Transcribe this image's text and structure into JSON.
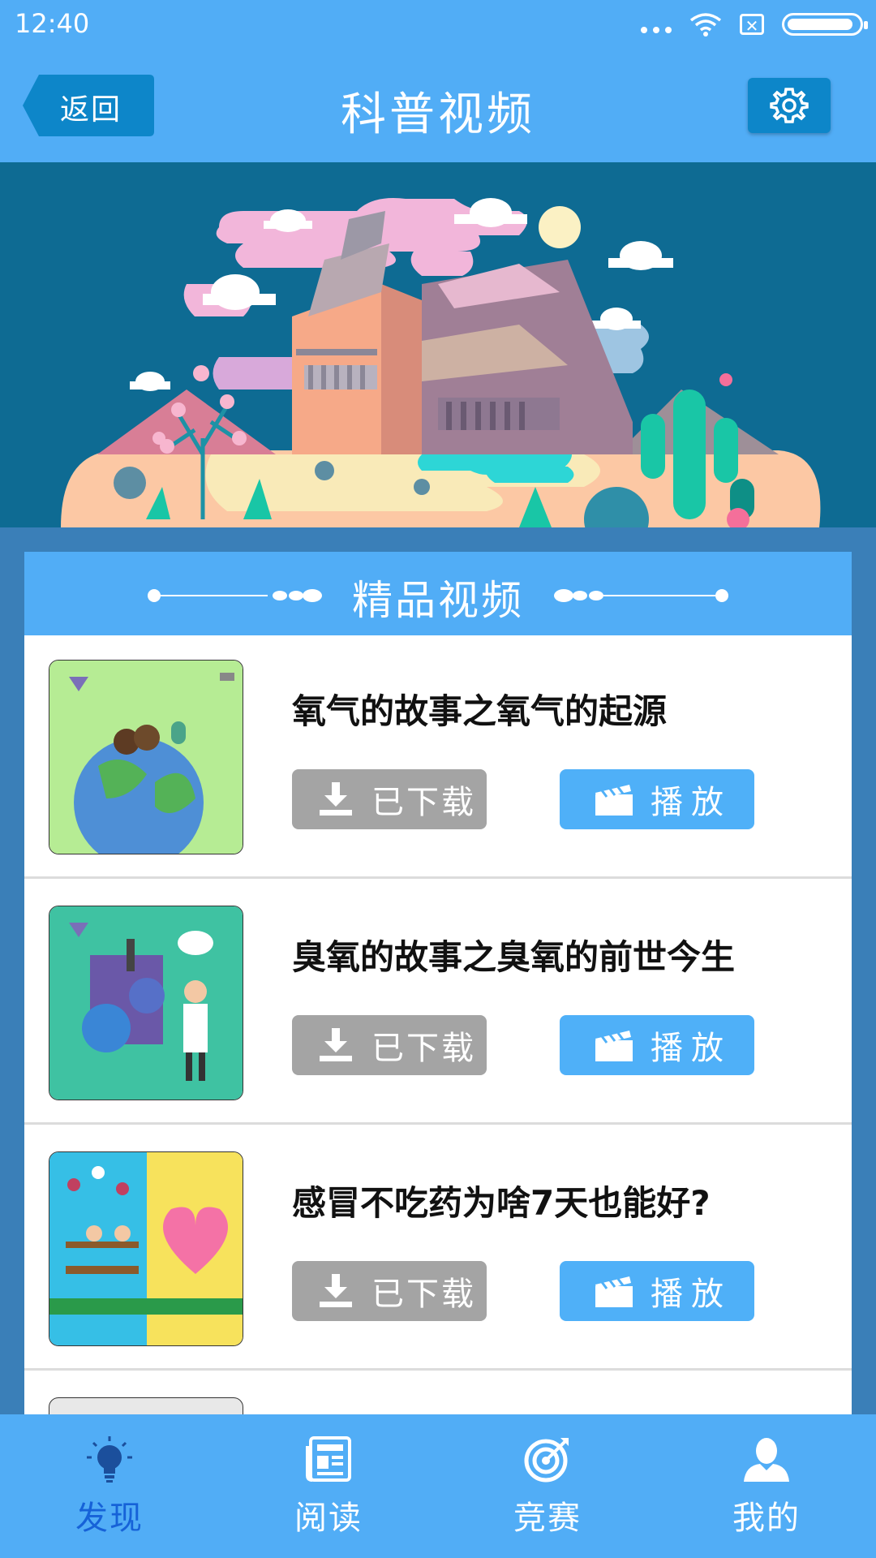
{
  "status_bar": {
    "time": "12:40"
  },
  "header": {
    "back_label": "返回",
    "title": "科普视频"
  },
  "section": {
    "title": "精品视频"
  },
  "videos": [
    {
      "title": "氧气的故事之氧气的起源",
      "download_label": "已下载",
      "play_label": "播放"
    },
    {
      "title": "臭氧的故事之臭氧的前世今生",
      "download_label": "已下载",
      "play_label": "播放"
    },
    {
      "title": "感冒不吃药为啥7天也能好?",
      "download_label": "已下载",
      "play_label": "播放"
    }
  ],
  "nav": [
    {
      "label": "发现",
      "icon": "bulb-icon",
      "active": true
    },
    {
      "label": "阅读",
      "icon": "newspaper-icon",
      "active": false
    },
    {
      "label": "竞赛",
      "icon": "target-icon",
      "active": false
    },
    {
      "label": "我的",
      "icon": "user-icon",
      "active": false
    }
  ],
  "colors": {
    "primary": "#51adf6",
    "accent_dark": "#0d86c9",
    "disabled": "#a4a4a4",
    "active_nav": "#1662d8"
  }
}
